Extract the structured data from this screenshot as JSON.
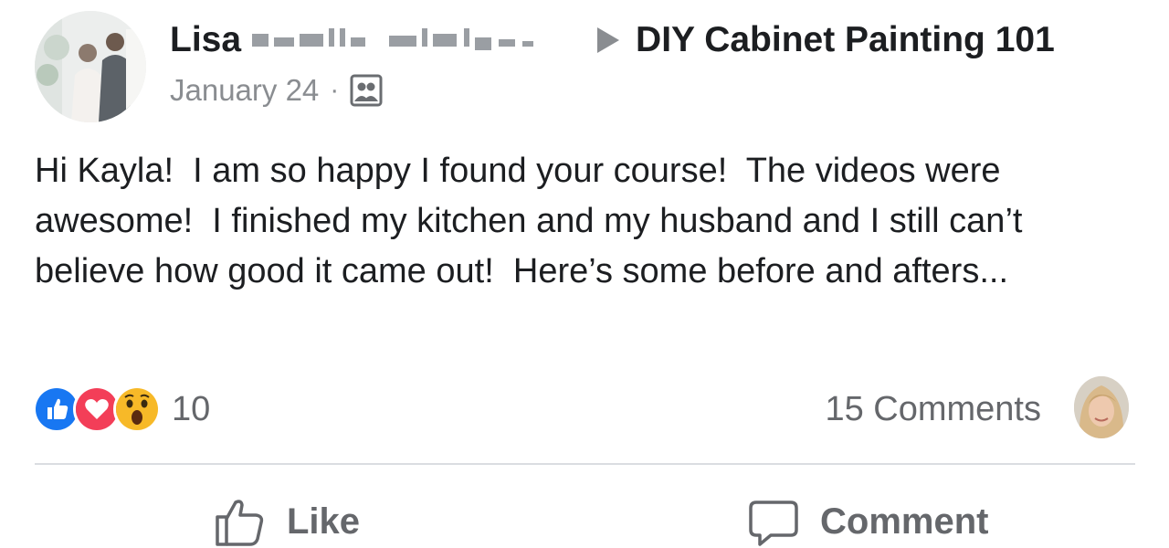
{
  "post": {
    "author_name": "Lisa",
    "group_name": "DIY Cabinet Painting 101",
    "date": "January 24",
    "separator": "·",
    "audience_icon": "group-members-icon",
    "text": "Hi Kayla!  I am so happy I found your course!  The videos were awesome!  I finished my kitchen and my husband and I still can’t believe how good it came out!  Here’s some before and afters..."
  },
  "reactions": {
    "types": [
      "like-reaction-icon",
      "love-reaction-icon",
      "wow-reaction-icon"
    ],
    "count": "10"
  },
  "comments": {
    "count_label": "15 Comments"
  },
  "actions": {
    "like_label": "Like",
    "comment_label": "Comment"
  },
  "colors": {
    "text": "#1c1e21",
    "secondary_text": "#65676b",
    "meta_text": "#8a8d91",
    "like_blue": "#1877f2",
    "love_red": "#f33e58",
    "wow_yellow": "#f7b928",
    "divider": "#dadde1"
  }
}
